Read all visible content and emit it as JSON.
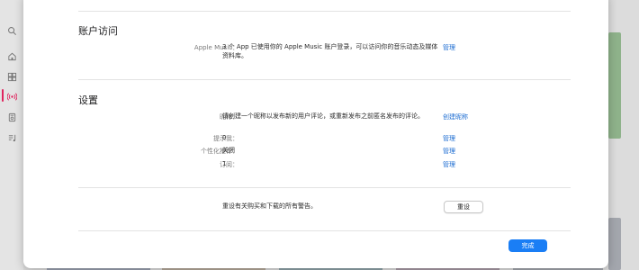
{
  "sidebar": {
    "icons": [
      "search-icon",
      "home-icon",
      "grid-icon",
      "radio-icon",
      "library-icon",
      "music-note-icon"
    ]
  },
  "account_access": {
    "title": "账户访问",
    "apple_music_label": "Apple Music：",
    "apple_music_value": "3 个 App 已使用你的 Apple Music 账户登录，可以访问你的音乐动态及媒体资料库。",
    "manage_label": "管理"
  },
  "settings": {
    "title": "设置",
    "rows": [
      {
        "label": "昵称：",
        "value": "请创建一个昵称以发布新的用户评论，或重新发布之前匿名发布的评论。",
        "action": "创建昵称"
      },
      {
        "label": "提示我：",
        "value": "0",
        "action": "管理"
      },
      {
        "label": "个性化推荐：",
        "value": "关闭",
        "action": "管理"
      },
      {
        "label": "订阅：",
        "value": "1",
        "action": "管理"
      }
    ]
  },
  "warnings": {
    "text": "重设有关购买和下载的所有警告。",
    "reset_label": "重设"
  },
  "footer": {
    "done_label": "完成"
  },
  "colors": {
    "accent": "#1a7ef5",
    "link": "#1a6bd1",
    "active_indicator": "#e0245e"
  }
}
